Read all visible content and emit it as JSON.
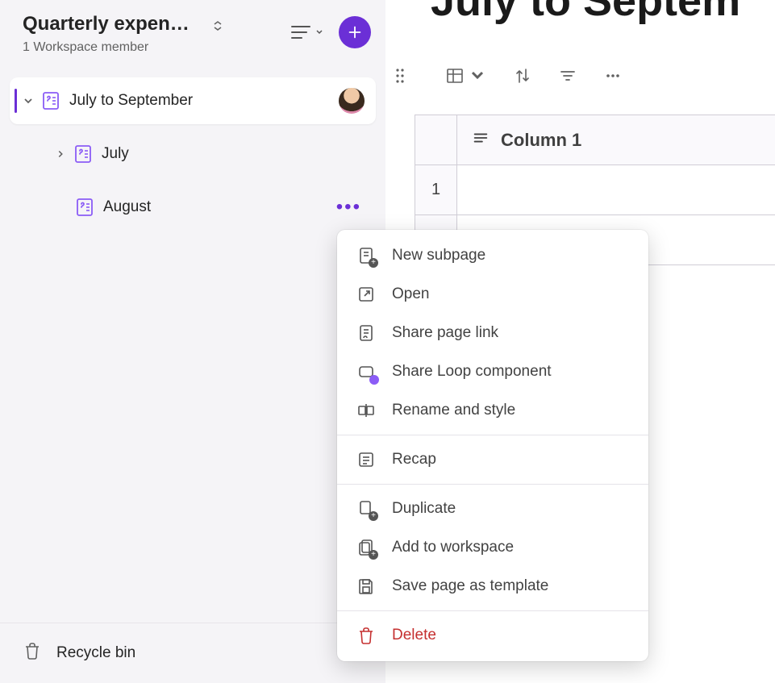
{
  "workspace": {
    "title": "Quarterly expendit…",
    "subtitle": "1 Workspace member"
  },
  "tree": {
    "active": {
      "label": "July to September"
    },
    "child1": {
      "label": "July"
    },
    "child2": {
      "label": "August"
    }
  },
  "footer": {
    "recycle": "Recycle bin"
  },
  "main": {
    "title": "July to Septem"
  },
  "table": {
    "col1": "Column 1",
    "row1": "1"
  },
  "menu": {
    "new_subpage": "New subpage",
    "open": "Open",
    "share_link": "Share page link",
    "share_loop": "Share Loop component",
    "rename": "Rename and style",
    "recap": "Recap",
    "duplicate": "Duplicate",
    "add_ws": "Add to workspace",
    "save_tpl": "Save page as template",
    "delete": "Delete"
  }
}
